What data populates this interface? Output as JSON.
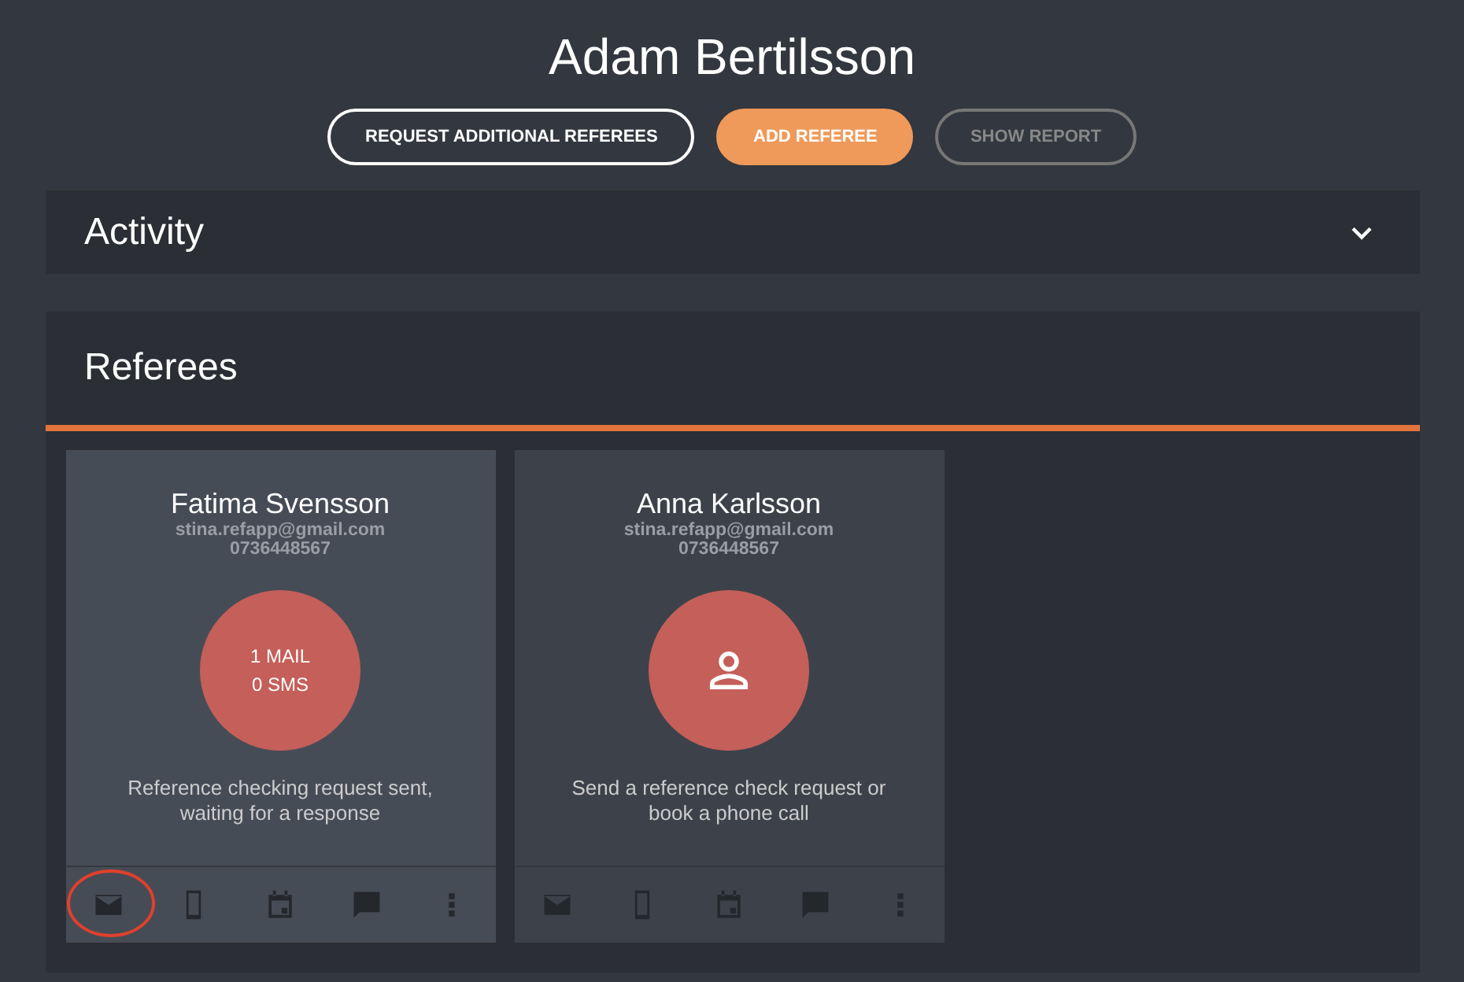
{
  "candidate": {
    "name": "Adam Bertilsson"
  },
  "buttons": [
    {
      "label": "REQUEST ADDITIONAL REFEREES",
      "kind": "outline"
    },
    {
      "label": "ADD REFEREE",
      "kind": "primary"
    },
    {
      "label": "SHOW REPORT",
      "kind": "disabled"
    }
  ],
  "activity": {
    "title": "Activity",
    "expanded": false
  },
  "referees": {
    "title": "Referees",
    "cards": [
      {
        "name": "Fatima Svensson",
        "email": "stina.refapp@gmail.com",
        "phone": "0736448567",
        "selected": true,
        "status": {
          "kind": "counts",
          "lines": [
            "1 MAIL",
            "0 SMS"
          ]
        },
        "message": "Reference checking request sent, waiting for a response",
        "actions": [
          {
            "circled": true
          },
          {
            "circled": false
          },
          {
            "circled": false
          },
          {
            "circled": false
          },
          {
            "circled": false
          }
        ]
      },
      {
        "name": "Anna Karlsson",
        "email": "stina.refapp@gmail.com",
        "phone": "0736448567",
        "selected": false,
        "status": {
          "kind": "person"
        },
        "message": "Send a reference check request or book a phone call",
        "actions": [
          {
            "circled": false
          },
          {
            "circled": false
          },
          {
            "circled": false
          },
          {
            "circled": false
          },
          {
            "circled": false
          }
        ]
      }
    ]
  }
}
